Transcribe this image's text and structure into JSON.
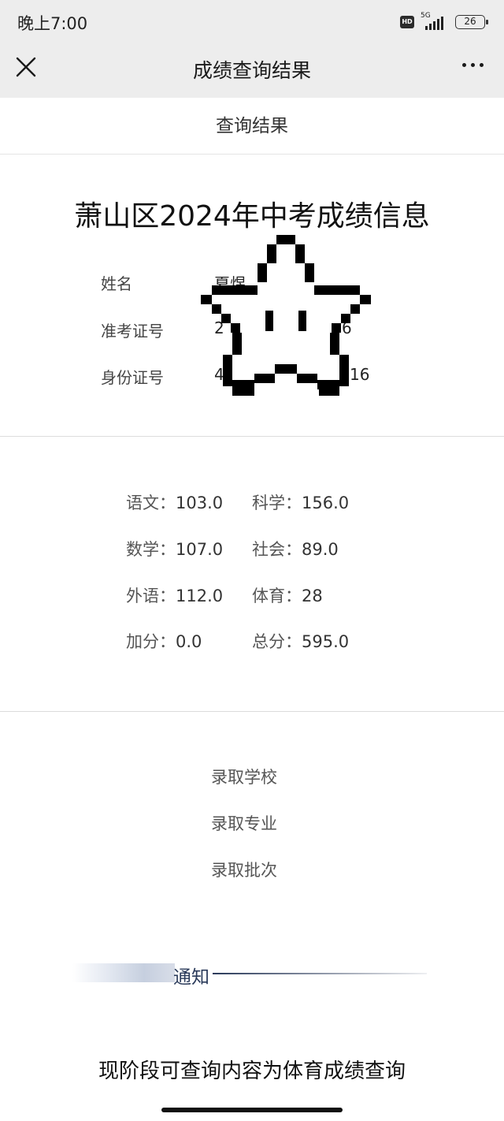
{
  "status_bar": {
    "time": "晚上7:00",
    "hd": "HD",
    "network": "5G",
    "battery": "26"
  },
  "nav": {
    "title": "成绩查询结果"
  },
  "section": {
    "header": "查询结果"
  },
  "result": {
    "title": "萧山区2024年中考成绩信息",
    "fields": [
      {
        "label": "姓名",
        "value": "夏煜"
      },
      {
        "label": "准考证号",
        "value": "2"
      },
      {
        "label": "身份证号",
        "value": "4"
      }
    ],
    "value_tails": [
      "6",
      "16"
    ]
  },
  "scores": [
    {
      "label": "语文：",
      "value": "103.0"
    },
    {
      "label": "科学：",
      "value": "156.0"
    },
    {
      "label": "数学：",
      "value": "107.0"
    },
    {
      "label": "社会：",
      "value": "89.0"
    },
    {
      "label": "外语：",
      "value": "112.0"
    },
    {
      "label": "体育：",
      "value": "28"
    },
    {
      "label": "加分：",
      "value": "0.0"
    },
    {
      "label": "总分：",
      "value": "595.0"
    }
  ],
  "admission": [
    {
      "label": "录取学校"
    },
    {
      "label": "录取专业"
    },
    {
      "label": "录取批次"
    }
  ],
  "notice": {
    "title": "通知"
  },
  "footer": {
    "text": "现阶段可查询内容为体育成绩查询"
  }
}
